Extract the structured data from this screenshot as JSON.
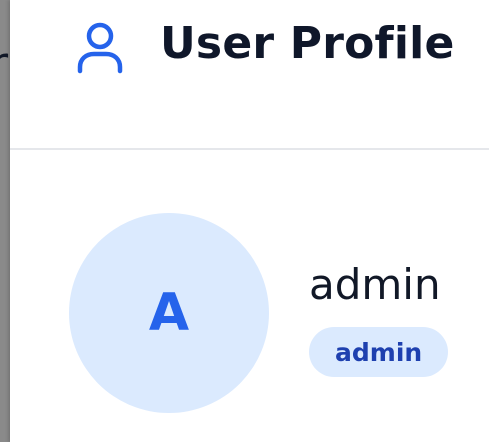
{
  "backdrop": {
    "partial_text": "r"
  },
  "header": {
    "icon": "user-icon",
    "title": "User Profile"
  },
  "profile": {
    "avatar_initial": "A",
    "username": "admin",
    "role": "admin"
  },
  "colors": {
    "accent": "#2563eb",
    "avatar_bg": "#dbeafe",
    "badge_bg": "#dbeafe",
    "badge_text": "#1e40af",
    "title_text": "#0f172a",
    "divider": "#e5e7eb"
  }
}
